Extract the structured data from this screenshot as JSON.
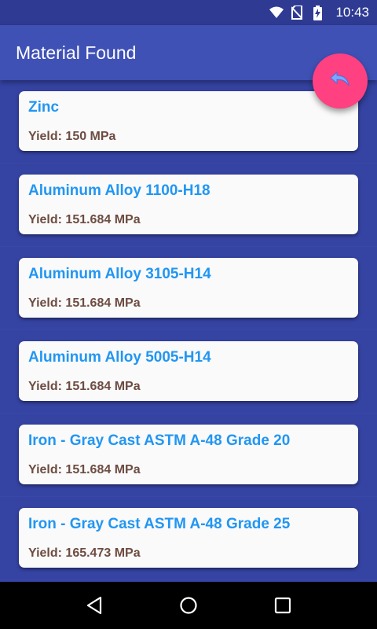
{
  "status_bar": {
    "time": "10:43",
    "icons": [
      "wifi-icon",
      "no-sim-icon",
      "battery-charging-icon"
    ]
  },
  "app_bar": {
    "title": "Material Found"
  },
  "fab": {
    "icon": "reply-icon",
    "color": "#ff4081"
  },
  "materials": [
    {
      "name": "Zinc",
      "yield": "Yield: 150 MPa"
    },
    {
      "name": "Aluminum Alloy 1100-H18",
      "yield": "Yield: 151.684 MPa"
    },
    {
      "name": "Aluminum Alloy 3105-H14",
      "yield": "Yield: 151.684 MPa"
    },
    {
      "name": "Aluminum Alloy 5005-H14",
      "yield": "Yield: 151.684 MPa"
    },
    {
      "name": "Iron - Gray Cast ASTM A-48 Grade 20",
      "yield": "Yield: 151.684 MPa"
    },
    {
      "name": "Iron - Gray Cast ASTM A-48 Grade 25",
      "yield": "Yield: 165.473 MPa"
    }
  ],
  "nav_bar": {
    "buttons": [
      "back-icon",
      "home-icon",
      "recents-icon"
    ]
  },
  "colors": {
    "primary": "#3f51b5",
    "primary_dark": "#2f3b92",
    "accent": "#ff4081",
    "material_name": "#2196f3",
    "yield_text": "#6d4c41"
  }
}
